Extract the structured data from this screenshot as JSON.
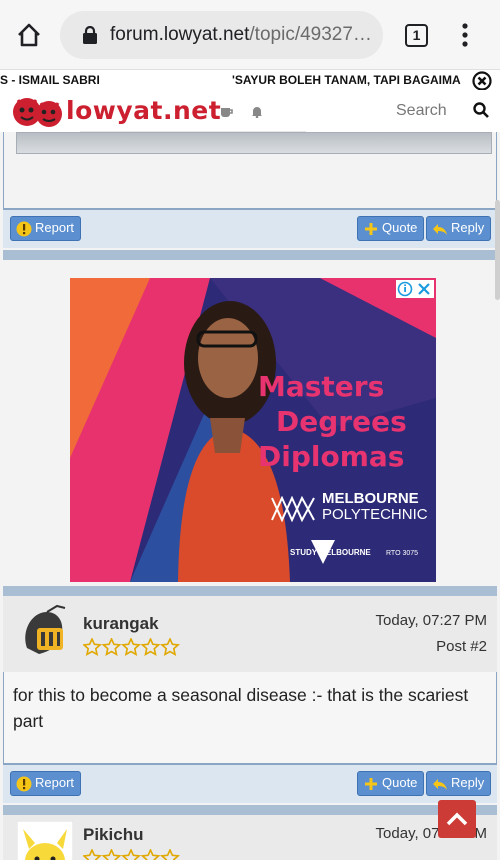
{
  "browser": {
    "url_domain": "forum.lowyat.net",
    "url_path": "/topic/49327…",
    "tab_count": "1"
  },
  "ticker": {
    "left_headline": "S - ISMAIL SABRI",
    "right_headline": "'SAYUR BOLEH TANAM, TAPI BAGAIMA"
  },
  "site": {
    "logo_text": "lowyat.net",
    "search_placeholder": "Search"
  },
  "actions": {
    "report_label": "Report",
    "quote_label": "Quote",
    "reply_label": "Reply"
  },
  "ad": {
    "lines": [
      "Masters",
      "Degrees",
      "Diplomas"
    ],
    "brand_line1": "MELBOURNE",
    "brand_line2": "POLYTECHNIC",
    "study_text": "STUDY MELBOURNE",
    "rto_text": "RTO 3075"
  },
  "posts": [
    {
      "username": "kurangak",
      "time": "Today, 07:27 PM",
      "post_number": "Post #2",
      "rating_stars": 5,
      "body": "for this to become a seasonal disease :- that is the scariest part"
    },
    {
      "username": "Pikichu",
      "time": "Today, 07:28 PM"
    }
  ],
  "colors": {
    "brand_red": "#cc1f2f",
    "button_blue": "#5b8fcf",
    "frame_blue": "#8aa6c4",
    "separator_blue": "#a9bdd3"
  }
}
